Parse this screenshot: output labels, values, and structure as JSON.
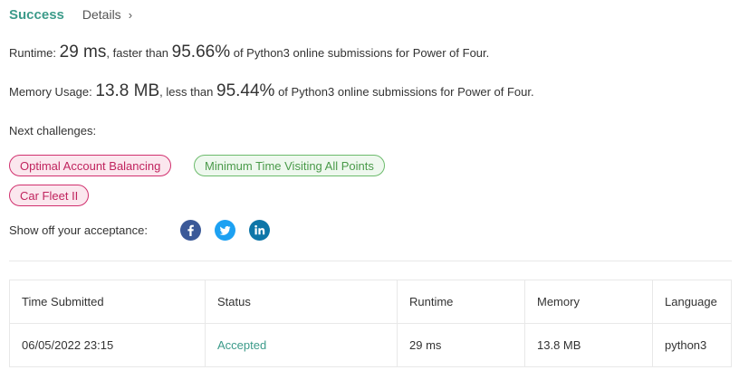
{
  "header": {
    "status": "Success",
    "details_label": "Details",
    "details_chevron": "›"
  },
  "runtime": {
    "label": "Runtime: ",
    "value": "29 ms",
    "comparison": ", faster than ",
    "percent": "95.66%",
    "suffix": " of Python3 online submissions for Power of Four."
  },
  "memory": {
    "label": "Memory Usage: ",
    "value": "13.8 MB",
    "comparison": ", less than ",
    "percent": "95.44%",
    "suffix": " of Python3 online submissions for Power of Four."
  },
  "next_challenges": {
    "label": "Next challenges:",
    "items": [
      {
        "label": "Optimal Account Balancing",
        "difficulty": "hard"
      },
      {
        "label": "Minimum Time Visiting All Points",
        "difficulty": "easy"
      },
      {
        "label": "Car Fleet II",
        "difficulty": "hard"
      }
    ]
  },
  "share": {
    "label": "Show off your acceptance:",
    "icons": [
      "facebook-icon",
      "twitter-icon",
      "linkedin-icon"
    ]
  },
  "table": {
    "headers": [
      "Time Submitted",
      "Status",
      "Runtime",
      "Memory",
      "Language"
    ],
    "rows": [
      [
        "06/05/2022 23:15",
        "Accepted",
        "29 ms",
        "13.8 MB",
        "python3"
      ]
    ]
  },
  "colors": {
    "success": "#3c9b8a",
    "hard": "#c0245e",
    "easy": "#4a9a4a",
    "facebook": "#3b5998",
    "twitter": "#1da1f2",
    "linkedin": "#0e76a8"
  }
}
